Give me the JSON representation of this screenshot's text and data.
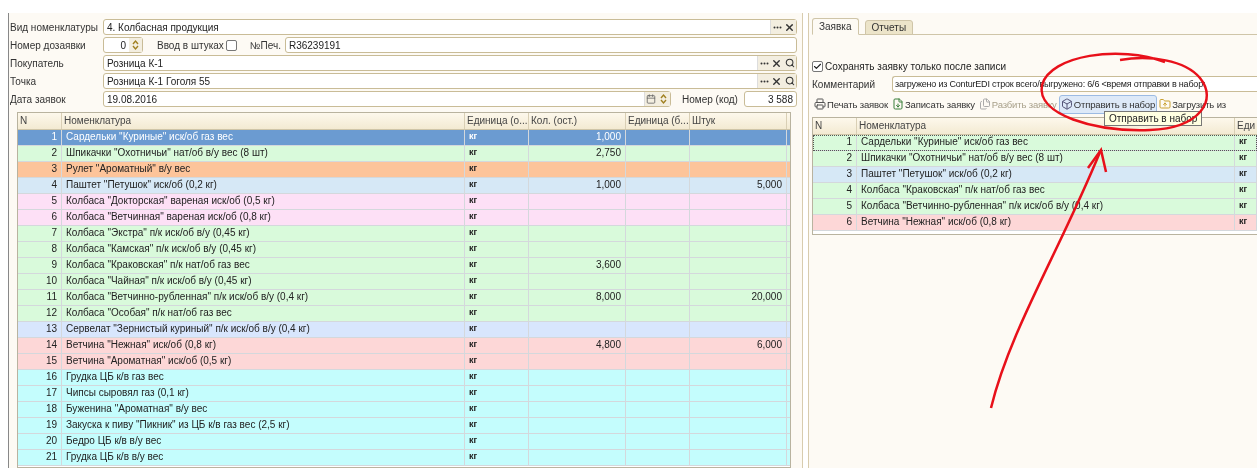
{
  "form": {
    "nomenclature_type": {
      "label": "Вид номенклатуры",
      "value": "4. Колбасная продукция",
      "kind": "select"
    },
    "addon_number": {
      "label": "Номер дозаявки",
      "value": "0"
    },
    "pieces_input": {
      "label": "Ввод в штуках",
      "checked": false
    },
    "print_number": {
      "label": "№Печ.",
      "value": "R36239191"
    },
    "buyer": {
      "label": "Покупатель",
      "value": "Розница К-1",
      "kind": "lookup"
    },
    "point": {
      "label": "Точка",
      "value": "Розница К-1 Гоголя 55",
      "kind": "lookup"
    },
    "date": {
      "label": "Дата заявок",
      "value": "19.08.2016"
    },
    "code_number": {
      "label": "Номер (код)",
      "value": "3 588"
    }
  },
  "main_table": {
    "columns": [
      "N",
      "Номенклатура",
      "Единица (о...",
      "Кол. (ост.)",
      "Единица (б...",
      "Штук"
    ],
    "rows": [
      {
        "n": "1",
        "name": "Сардельки \"Куриные\" иск/об газ вес",
        "unit": "кг",
        "qty": "1,000",
        "selected": true
      },
      {
        "n": "2",
        "name": "Шпикачки \"Охотничьи\" нат/об в/у вес (8 шт)",
        "unit": "кг",
        "qty": "2,750",
        "color": "#d9fadb",
        "selected": false
      },
      {
        "n": "3",
        "name": "Рулет \"Ароматный\" в/у вес",
        "unit": "кг",
        "color": "#fdc49a",
        "selected": false
      },
      {
        "n": "4",
        "name": "Паштет \"Петушок\" иск/об (0,2 кг)",
        "unit": "кг",
        "qty": "1,000",
        "pieces": "5,000",
        "color": "#d6e8f6",
        "selected": false
      },
      {
        "n": "5",
        "name": "Колбаса \"Докторская\" вареная иск/об (0,5 кг)",
        "unit": "кг",
        "color": "#fde0f6",
        "selected": false
      },
      {
        "n": "6",
        "name": "Колбаса \"Ветчинная\" вареная иск/об (0,8 кг)",
        "unit": "кг",
        "color": "#fde0f6",
        "selected": false
      },
      {
        "n": "7",
        "name": "Колбаса \"Экстра\" п/к иск/об в/у (0,45 кг)",
        "unit": "кг",
        "color": "#d9fadb",
        "selected": false
      },
      {
        "n": "8",
        "name": "Колбаса \"Камская\" п/к иск/об в/у (0,45 кг)",
        "unit": "кг",
        "color": "#d9fadb",
        "selected": false
      },
      {
        "n": "9",
        "name": "Колбаса \"Краковская\" п/к нат/об газ вес",
        "unit": "кг",
        "qty": "3,600",
        "color": "#d9fadb",
        "selected": false
      },
      {
        "n": "10",
        "name": "Колбаса \"Чайная\" п/к иск/об в/у (0,45 кг)",
        "unit": "кг",
        "color": "#d9fadb",
        "selected": false
      },
      {
        "n": "11",
        "name": "Колбаса \"Ветчинно-рубленная\" п/к иск/об в/у (0,4 кг)",
        "unit": "кг",
        "qty": "8,000",
        "pieces": "20,000",
        "color": "#d9fadb",
        "selected": false
      },
      {
        "n": "12",
        "name": "Колбаса \"Особая\" п/к нат/об газ вес",
        "unit": "кг",
        "color": "#d9fadb",
        "selected": false
      },
      {
        "n": "13",
        "name": "Сервелат \"Зернистый куриный\" п/к иск/об в/у (0,4 кг)",
        "unit": "кг",
        "color": "#d8e6fd",
        "selected": false
      },
      {
        "n": "14",
        "name": "Ветчина \"Нежная\" иск/об (0,8 кг)",
        "unit": "кг",
        "qty": "4,800",
        "pieces": "6,000",
        "color": "#fdd7d7",
        "selected": false
      },
      {
        "n": "15",
        "name": "Ветчина \"Ароматная\" иск/об (0,5 кг)",
        "unit": "кг",
        "color": "#fdd7d7",
        "selected": false
      },
      {
        "n": "16",
        "name": "Грудка ЦБ к/в газ вес",
        "unit": "кг",
        "color": "#c4fdfd",
        "selected": false
      },
      {
        "n": "17",
        "name": "Чипсы сыровял газ (0,1 кг)",
        "unit": "кг",
        "color": "#c4fdfd",
        "selected": false
      },
      {
        "n": "18",
        "name": "Буженина \"Ароматная\" в/у вес",
        "unit": "кг",
        "color": "#c4fdfd",
        "selected": false
      },
      {
        "n": "19",
        "name": "Закуска к пиву \"Пикник\" из ЦБ к/в газ вес (2,5 кг)",
        "unit": "кг",
        "color": "#c4fdfd",
        "selected": false
      },
      {
        "n": "20",
        "name": "Бедро ЦБ к/в в/у вес",
        "unit": "кг",
        "color": "#c4fdfd",
        "selected": false
      },
      {
        "n": "21",
        "name": "Грудка ЦБ к/в в/у вес",
        "unit": "кг",
        "color": "#c4fdfd",
        "selected": false
      }
    ]
  },
  "tabs": [
    {
      "label": "Заявка",
      "selected": true
    },
    {
      "label": "Отчеты",
      "selected": false
    }
  ],
  "save_after_write": {
    "label": "Сохранять заявку только после записи",
    "checked": true
  },
  "comment": {
    "label": "Комментарий",
    "value": "загружено из ConturEDI строк всего/выгружено: 6/6 <время отправки в набор:"
  },
  "toolbar": [
    {
      "kind": "print",
      "label": "Печать заявок",
      "disabled": false,
      "highlighted": false
    },
    {
      "kind": "save",
      "label": "Записать заявку",
      "disabled": false,
      "highlighted": false
    },
    {
      "kind": "split",
      "label": "Разбить заявку",
      "disabled": true,
      "highlighted": false
    },
    {
      "kind": "send",
      "label": "Отправить в набор",
      "disabled": false,
      "highlighted": true
    },
    {
      "kind": "load",
      "label": "Загрузить из",
      "disabled": false,
      "highlighted": false
    }
  ],
  "tooltip": "Отправить в набор",
  "order_table": {
    "columns": [
      "N",
      "Номенклатура",
      "Еди"
    ],
    "rows": [
      {
        "n": "1",
        "name": "Сардельки \"Куриные\" иск/об газ вес",
        "unit": "кг",
        "color": "#d9fadb",
        "selected": true
      },
      {
        "n": "2",
        "name": "Шпикачки \"Охотничьи\" нат/об в/у вес (8 шт)",
        "unit": "кг",
        "color": "#d9fadb",
        "selected": false
      },
      {
        "n": "3",
        "name": "Паштет \"Петушок\" иск/об (0,2 кг)",
        "unit": "кг",
        "color": "#d6e8f6",
        "selected": false
      },
      {
        "n": "4",
        "name": "Колбаса \"Краковская\" п/к нат/об газ вес",
        "unit": "кг",
        "color": "#d9fadb",
        "selected": false
      },
      {
        "n": "5",
        "name": "Колбаса \"Ветчинно-рубленная\" п/к иск/об в/у (0,4 кг)",
        "unit": "кг",
        "color": "#d9fadb",
        "selected": false
      },
      {
        "n": "6",
        "name": "Ветчина \"Нежная\" иск/об (0,8 кг)",
        "unit": "кг",
        "color": "#fdd7d7",
        "selected": false
      }
    ]
  }
}
